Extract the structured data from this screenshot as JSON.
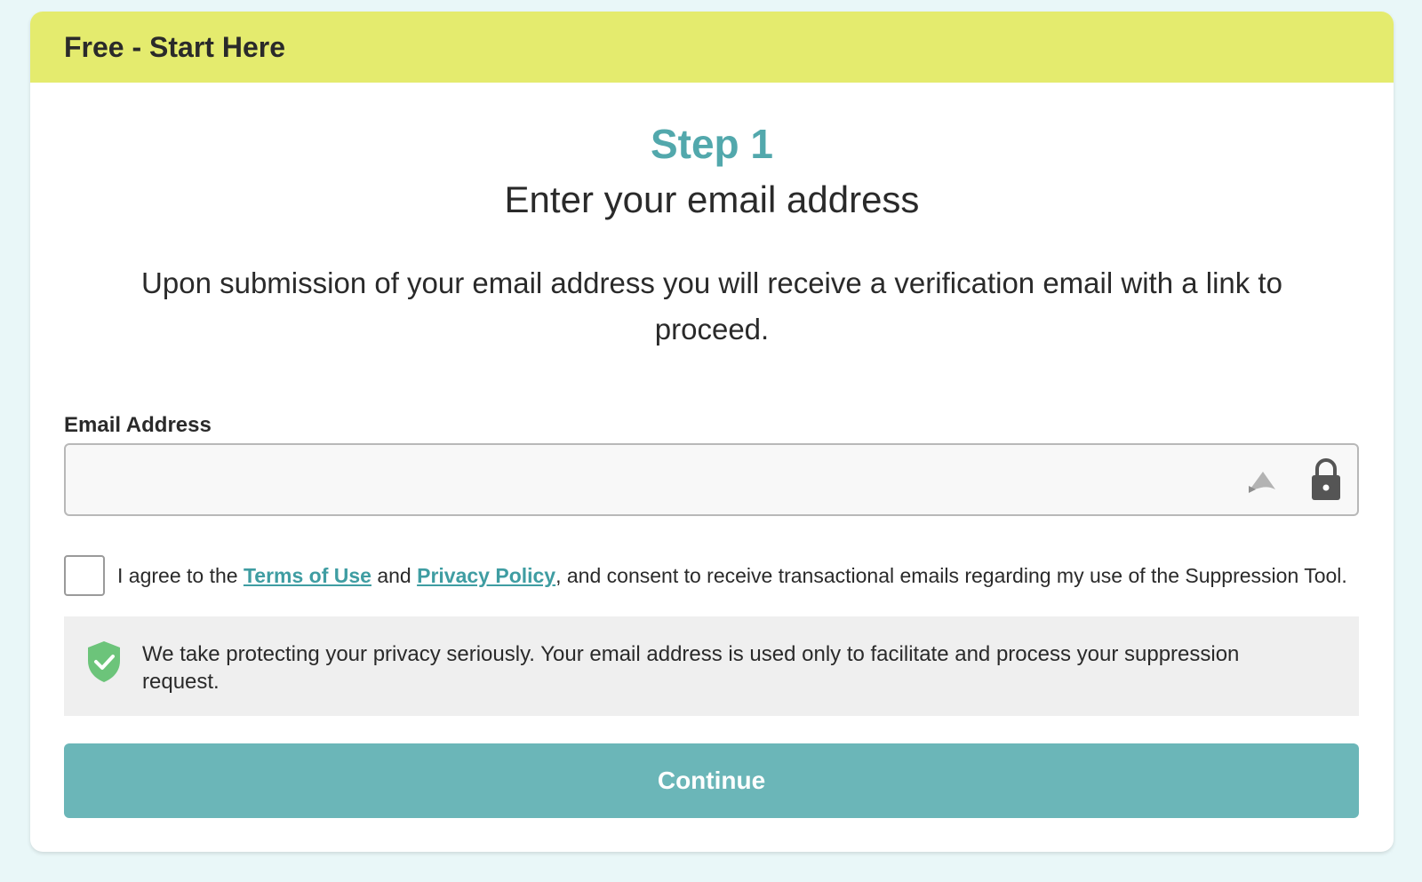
{
  "header": {
    "title": "Free - Start Here"
  },
  "step": {
    "title": "Step 1",
    "subtitle": "Enter your email address",
    "description": "Upon submission of your email address you will receive a verification email with a link to proceed."
  },
  "email": {
    "label": "Email Address",
    "value": "",
    "placeholder": ""
  },
  "consent": {
    "prefix": "I agree to the ",
    "terms_link": "Terms of Use",
    "and_text": " and ",
    "privacy_link": "Privacy Policy",
    "suffix": ", and consent to receive transactional emails regarding my use of the Suppression Tool.",
    "checked": false
  },
  "privacy_notice": {
    "text": "We take protecting your privacy seriously. Your email address is used only to facilitate and process your suppression request."
  },
  "continue_button": {
    "label": "Continue"
  },
  "icons": {
    "autofill": "autofill-icon",
    "lock": "lock-icon",
    "shield": "shield-check-icon"
  },
  "colors": {
    "header_bg": "#e4eb6e",
    "accent": "#52a8ac",
    "link": "#3f9da2",
    "button_bg": "#6bb6b8",
    "shield": "#6cc47a",
    "page_bg": "#e9f7f8"
  }
}
